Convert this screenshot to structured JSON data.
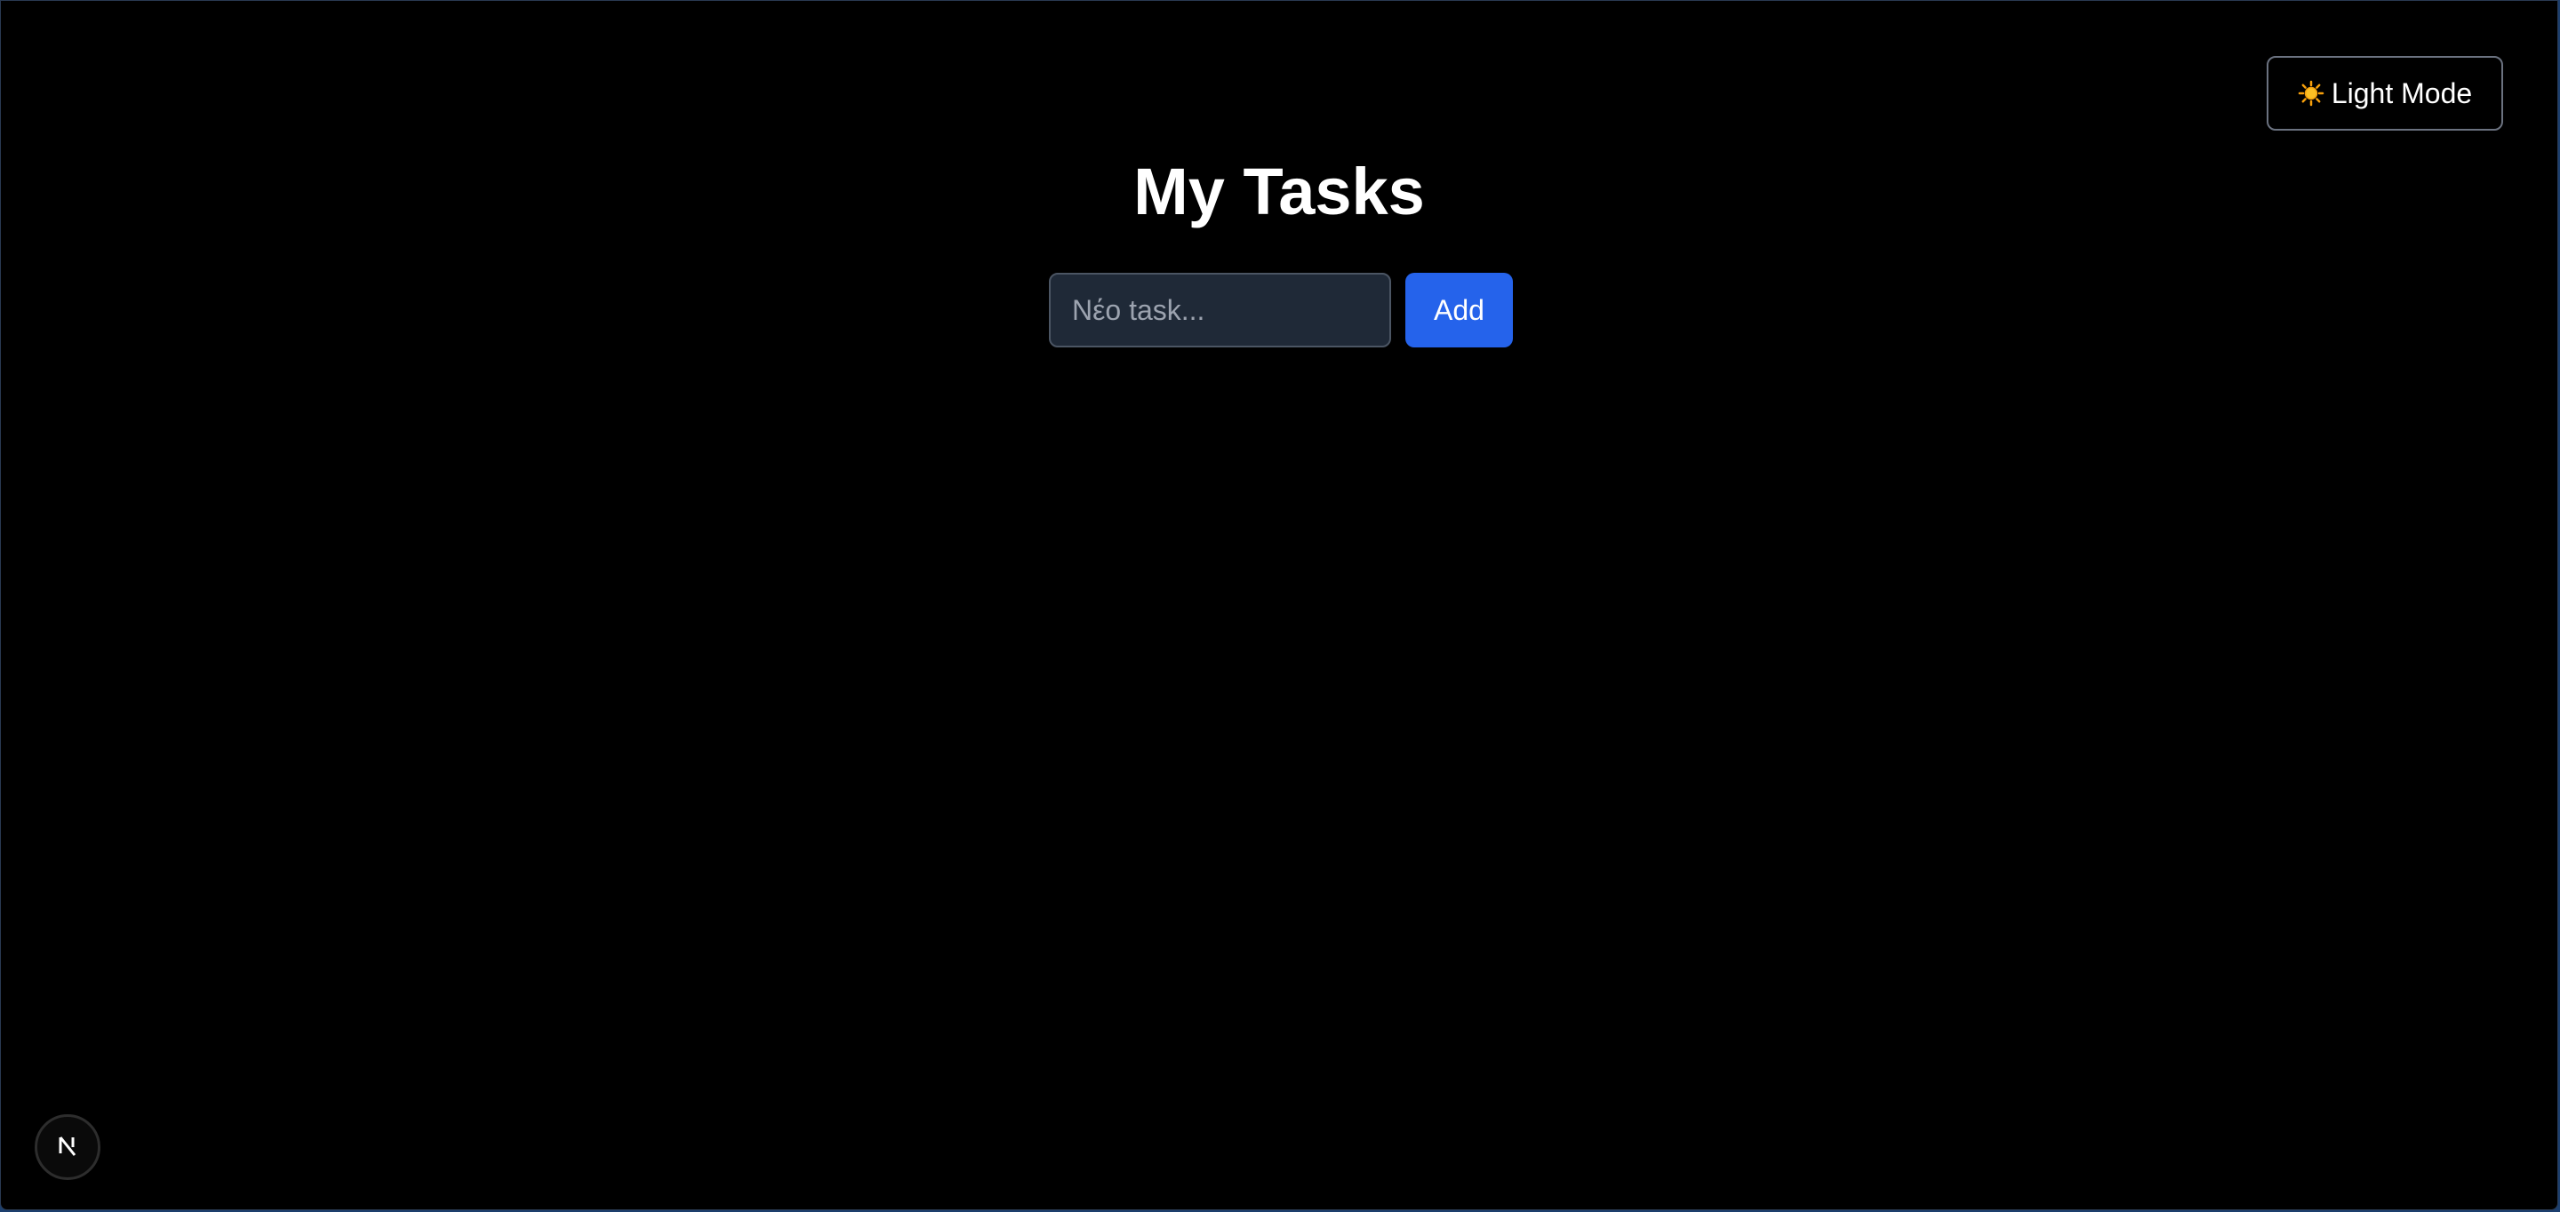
{
  "header": {
    "theme_toggle_label": "Light Mode",
    "theme_toggle_icon": "sun-icon"
  },
  "main": {
    "title": "My Tasks",
    "task_input": {
      "placeholder": "Νέο task...",
      "value": ""
    },
    "add_label": "Add"
  },
  "footer": {
    "badge_icon": "nextjs-logo-icon"
  },
  "colors": {
    "background": "#000000",
    "accent": "#2563eb",
    "input_background": "#1f2937",
    "sun": "#f59e0b"
  }
}
